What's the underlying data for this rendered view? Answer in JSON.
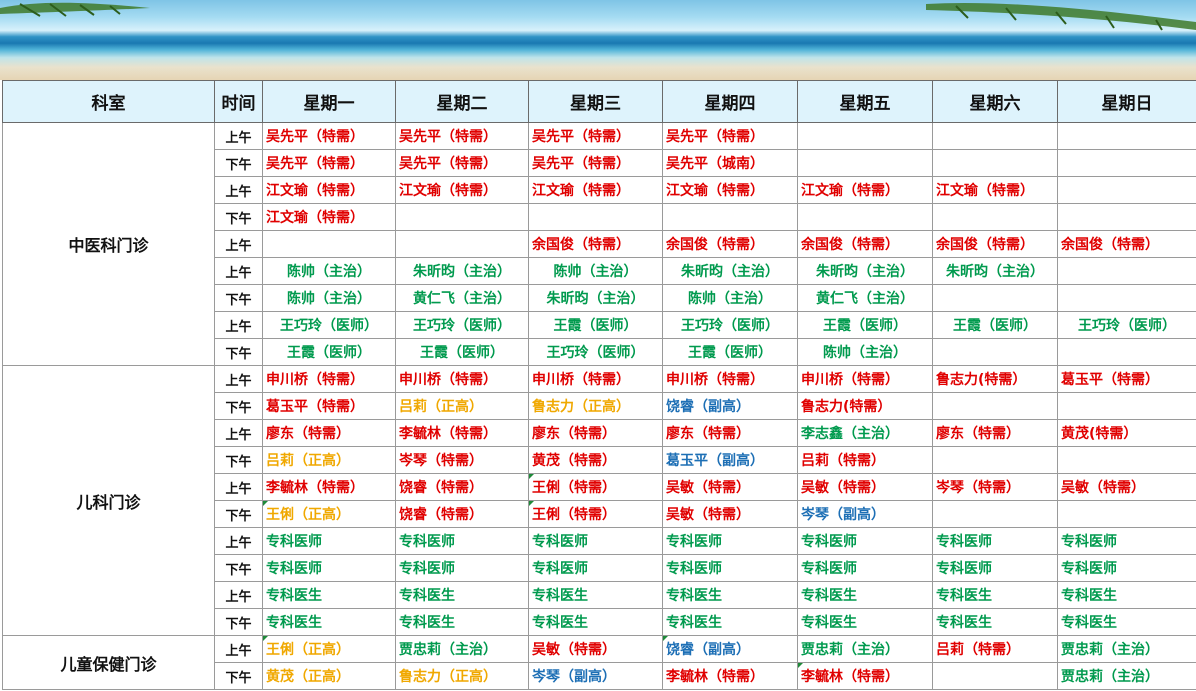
{
  "colors": {
    "red": "#e00000",
    "green": "#009a4e",
    "gold": "#f0a800",
    "blue": "#1d6fb5",
    "header_bg": "#def3fc"
  },
  "header": [
    "科室",
    "时间",
    "星期一",
    "星期二",
    "星期三",
    "星期四",
    "星期五",
    "星期六",
    "星期日"
  ],
  "time_am": "上午",
  "time_pm": "下午",
  "departments": [
    {
      "name": "中医科门诊",
      "rows": [
        {
          "time": "上午",
          "cells": [
            [
              "吴先平（特需）",
              "red"
            ],
            [
              "吴先平（特需）",
              "red"
            ],
            [
              "吴先平（特需）",
              "red"
            ],
            [
              "吴先平（特需）",
              "red"
            ],
            [
              "",
              ""
            ],
            [
              "",
              ""
            ],
            [
              "",
              ""
            ]
          ]
        },
        {
          "time": "下午",
          "cells": [
            [
              "吴先平（特需）",
              "red"
            ],
            [
              "吴先平（特需）",
              "red"
            ],
            [
              "吴先平（特需）",
              "red"
            ],
            [
              "吴先平（城南）",
              "red"
            ],
            [
              "",
              ""
            ],
            [
              "",
              ""
            ],
            [
              "",
              ""
            ]
          ]
        },
        {
          "time": "上午",
          "cells": [
            [
              "江文瑜（特需）",
              "red"
            ],
            [
              "江文瑜（特需）",
              "red"
            ],
            [
              "江文瑜（特需）",
              "red"
            ],
            [
              "江文瑜（特需）",
              "red"
            ],
            [
              "江文瑜（特需）",
              "red"
            ],
            [
              "江文瑜（特需）",
              "red"
            ],
            [
              "",
              ""
            ]
          ]
        },
        {
          "time": "下午",
          "cells": [
            [
              "江文瑜（特需）",
              "red"
            ],
            [
              "",
              ""
            ],
            [
              "",
              ""
            ],
            [
              "",
              ""
            ],
            [
              "",
              ""
            ],
            [
              "",
              ""
            ],
            [
              "",
              ""
            ]
          ]
        },
        {
          "time": "上午",
          "cells": [
            [
              "",
              ""
            ],
            [
              "",
              ""
            ],
            [
              "余国俊（特需）",
              "red"
            ],
            [
              "余国俊（特需）",
              "red"
            ],
            [
              "余国俊（特需）",
              "red"
            ],
            [
              "余国俊（特需）",
              "red"
            ],
            [
              "余国俊（特需）",
              "red"
            ]
          ]
        },
        {
          "time": "上午",
          "cells": [
            [
              "陈帅（主治）",
              "grn c"
            ],
            [
              "朱昕昀（主治）",
              "grn c"
            ],
            [
              "陈帅（主治）",
              "grn c"
            ],
            [
              "朱昕昀（主治）",
              "grn c"
            ],
            [
              "朱昕昀（主治）",
              "grn c"
            ],
            [
              "朱昕昀（主治）",
              "grn c"
            ],
            [
              "",
              ""
            ]
          ]
        },
        {
          "time": "下午",
          "cells": [
            [
              "陈帅（主治）",
              "grn c"
            ],
            [
              "黄仁飞（主治）",
              "grn c"
            ],
            [
              "朱昕昀（主治）",
              "grn c"
            ],
            [
              "陈帅（主治）",
              "grn c"
            ],
            [
              "黄仁飞（主治）",
              "grn c"
            ],
            [
              "",
              ""
            ],
            [
              "",
              ""
            ]
          ]
        },
        {
          "time": "上午",
          "cells": [
            [
              "王巧玲（医师）",
              "grn c"
            ],
            [
              "王巧玲（医师）",
              "grn c"
            ],
            [
              "王霞（医师）",
              "grn c"
            ],
            [
              "王巧玲（医师）",
              "grn c"
            ],
            [
              "王霞（医师）",
              "grn c"
            ],
            [
              "王霞（医师）",
              "grn c"
            ],
            [
              "王巧玲（医师）",
              "grn c"
            ]
          ]
        },
        {
          "time": "下午",
          "cells": [
            [
              "王霞（医师）",
              "grn c"
            ],
            [
              "王霞（医师）",
              "grn c"
            ],
            [
              "王巧玲（医师）",
              "grn c"
            ],
            [
              "王霞（医师）",
              "grn c"
            ],
            [
              "陈帅（主治）",
              "grn c"
            ],
            [
              "",
              ""
            ],
            [
              "",
              ""
            ]
          ]
        }
      ]
    },
    {
      "name": "儿科门诊",
      "rows": [
        {
          "time": "上午",
          "cells": [
            [
              "申川桥（特需）",
              "red"
            ],
            [
              "申川桥（特需）",
              "red"
            ],
            [
              "申川桥（特需）",
              "red"
            ],
            [
              "申川桥（特需）",
              "red"
            ],
            [
              "申川桥（特需）",
              "red"
            ],
            [
              "鲁志力(特需）",
              "red"
            ],
            [
              "葛玉平（特需）",
              "red"
            ]
          ]
        },
        {
          "time": "下午",
          "cells": [
            [
              "葛玉平（特需）",
              "red"
            ],
            [
              "吕莉（正高）",
              "gld"
            ],
            [
              "鲁志力（正高）",
              "gld"
            ],
            [
              "饶睿（副高）",
              "blu"
            ],
            [
              "鲁志力(特需）",
              "red"
            ],
            [
              "",
              ""
            ],
            [
              "",
              ""
            ]
          ]
        },
        {
          "time": "上午",
          "cells": [
            [
              "廖东（特需）",
              "red"
            ],
            [
              "李毓林（特需）",
              "red"
            ],
            [
              "廖东（特需）",
              "red"
            ],
            [
              "廖东（特需）",
              "red"
            ],
            [
              "李志鑫（主治）",
              "grn"
            ],
            [
              "廖东（特需）",
              "red"
            ],
            [
              "黄茂(特需）",
              "red"
            ]
          ]
        },
        {
          "time": "下午",
          "cells": [
            [
              "吕莉（正高）",
              "gld"
            ],
            [
              "岑琴（特需）",
              "red"
            ],
            [
              "黄茂（特需）",
              "red"
            ],
            [
              "葛玉平（副高）",
              "blu"
            ],
            [
              "吕莉（特需）",
              "red"
            ],
            [
              "",
              ""
            ],
            [
              "",
              ""
            ]
          ]
        },
        {
          "time": "上午",
          "cells": [
            [
              "李毓林（特需）",
              "red"
            ],
            [
              "饶睿（特需）",
              "red"
            ],
            [
              "王俐（特需）",
              "red mark"
            ],
            [
              "吴敏（特需）",
              "red"
            ],
            [
              "吴敏（特需）",
              "red"
            ],
            [
              "岑琴（特需）",
              "red"
            ],
            [
              "吴敏（特需）",
              "red"
            ]
          ]
        },
        {
          "time": "下午",
          "cells": [
            [
              "王俐（正高）",
              "gld mark"
            ],
            [
              "饶睿（特需）",
              "red"
            ],
            [
              "王俐（特需）",
              "red mark"
            ],
            [
              "吴敏（特需）",
              "red"
            ],
            [
              "岑琴（副高）",
              "blu"
            ],
            [
              "",
              ""
            ],
            [
              "",
              ""
            ]
          ]
        },
        {
          "time": "上午",
          "cells": [
            [
              "专科医师",
              "grn"
            ],
            [
              "专科医师",
              "grn"
            ],
            [
              "专科医师",
              "grn"
            ],
            [
              "专科医师",
              "grn"
            ],
            [
              "专科医师",
              "grn"
            ],
            [
              "专科医师",
              "grn"
            ],
            [
              "专科医师",
              "grn"
            ]
          ]
        },
        {
          "time": "下午",
          "cells": [
            [
              "专科医师",
              "grn"
            ],
            [
              "专科医师",
              "grn"
            ],
            [
              "专科医师",
              "grn"
            ],
            [
              "专科医师",
              "grn"
            ],
            [
              "专科医师",
              "grn"
            ],
            [
              "专科医师",
              "grn"
            ],
            [
              "专科医师",
              "grn"
            ]
          ]
        },
        {
          "time": "上午",
          "cells": [
            [
              "专科医生",
              "grn"
            ],
            [
              "专科医生",
              "grn"
            ],
            [
              "专科医生",
              "grn"
            ],
            [
              "专科医生",
              "grn"
            ],
            [
              "专科医生",
              "grn"
            ],
            [
              "专科医生",
              "grn"
            ],
            [
              "专科医生",
              "grn"
            ]
          ]
        },
        {
          "time": "下午",
          "cells": [
            [
              "专科医生",
              "grn"
            ],
            [
              "专科医生",
              "grn"
            ],
            [
              "专科医生",
              "grn"
            ],
            [
              "专科医生",
              "grn"
            ],
            [
              "专科医生",
              "grn"
            ],
            [
              "专科医生",
              "grn"
            ],
            [
              "专科医生",
              "grn"
            ]
          ]
        }
      ]
    },
    {
      "name": "儿童保健门诊",
      "rows": [
        {
          "time": "上午",
          "cells": [
            [
              "王俐（正高）",
              "gld mark"
            ],
            [
              "贾忠莉（主治）",
              "grn"
            ],
            [
              "吴敏（特需）",
              "red"
            ],
            [
              "饶睿（副高）",
              "blu mark"
            ],
            [
              "贾忠莉（主治）",
              "grn"
            ],
            [
              "吕莉（特需）",
              "red"
            ],
            [
              "贾忠莉（主治）",
              "grn"
            ]
          ]
        },
        {
          "time": "下午",
          "cells": [
            [
              "黄茂（正高）",
              "gld"
            ],
            [
              "鲁志力（正高）",
              "gld"
            ],
            [
              "岑琴（副高）",
              "blu"
            ],
            [
              "李毓林（特需）",
              "red"
            ],
            [
              "李毓林（特需）",
              "red mark"
            ],
            [
              "",
              ""
            ],
            [
              "贾忠莉（主治）",
              "grn"
            ]
          ]
        }
      ]
    }
  ]
}
